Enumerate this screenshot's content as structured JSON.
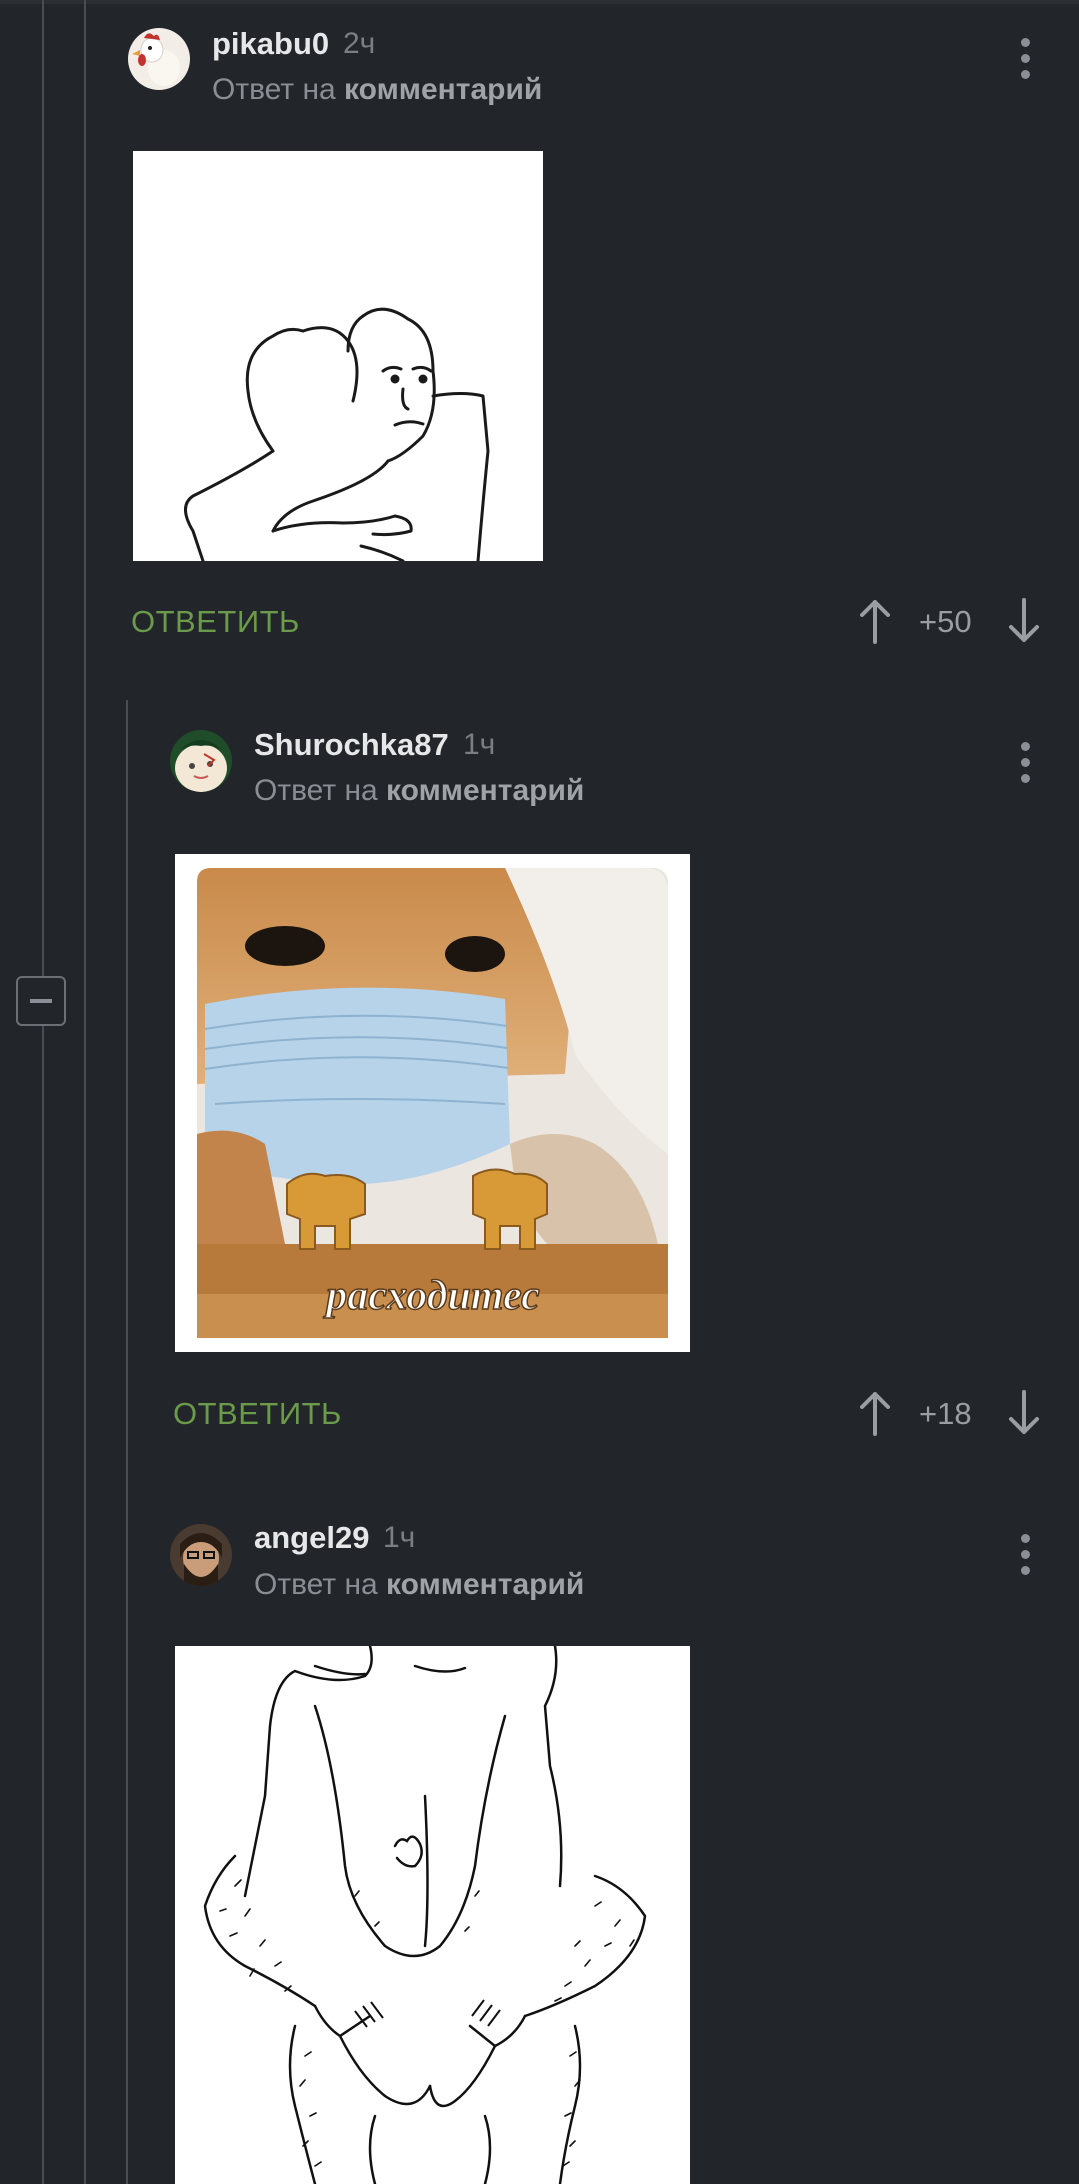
{
  "comments": [
    {
      "username": "pikabu0",
      "time": "2ч",
      "reply_prefix": "Ответ на",
      "reply_link": "комментарий",
      "reply_label": "ОТВЕТИТЬ",
      "rating": "+50"
    },
    {
      "username": "Shurochka87",
      "time": "1ч",
      "reply_prefix": "Ответ на",
      "reply_link": "комментарий",
      "reply_label": "ОТВЕТИТЬ",
      "rating": "+18",
      "image_caption": "расходитес"
    },
    {
      "username": "angel29",
      "time": "1ч",
      "reply_prefix": "Ответ на",
      "reply_link": "комментарий"
    }
  ],
  "colors": {
    "background": "#222529",
    "reply_green": "#6a9a4a",
    "text_primary": "#e6e7e8",
    "text_muted": "#8a8e94"
  },
  "icons": [
    "more-vert-icon",
    "upvote-arrow-icon",
    "downvote-arrow-icon",
    "collapse-thread-icon"
  ]
}
